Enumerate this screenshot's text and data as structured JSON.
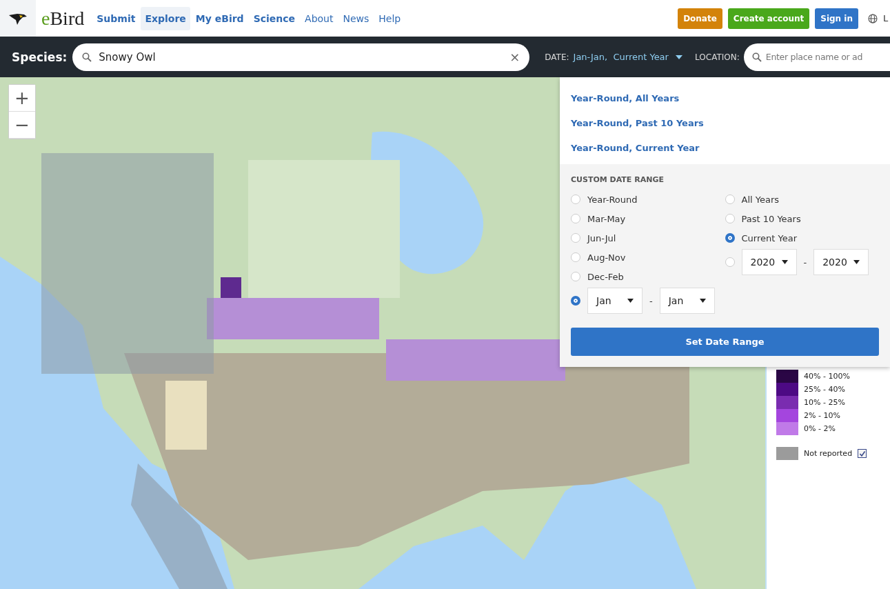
{
  "header": {
    "logo": {
      "prefix": "e",
      "name": "Bird"
    },
    "nav": [
      {
        "label": "Submit",
        "selected": false,
        "kind": "primary"
      },
      {
        "label": "Explore",
        "selected": true,
        "kind": "primary"
      },
      {
        "label": "My eBird",
        "selected": false,
        "kind": "primary"
      },
      {
        "label": "Science",
        "selected": false,
        "kind": "primary"
      },
      {
        "label": "About",
        "selected": false,
        "kind": "secondary"
      },
      {
        "label": "News",
        "selected": false,
        "kind": "secondary"
      },
      {
        "label": "Help",
        "selected": false,
        "kind": "secondary"
      }
    ],
    "buttons": [
      {
        "label": "Donate",
        "color": "#d3830a"
      },
      {
        "label": "Create account",
        "color": "#4aa81b"
      },
      {
        "label": "Sign in",
        "color": "#2f74c7"
      }
    ],
    "language": "L"
  },
  "toolbar": {
    "species_label": "Species:",
    "species_value": "Snowy Owl",
    "clear": "×",
    "date_label": "DATE:",
    "date_value": "Jan-Jan,  Current Year",
    "location_label": "LOCATION:",
    "location_placeholder": "Enter place name or ad"
  },
  "map": {
    "zoom_in": "+",
    "zoom_out": "−"
  },
  "date_menu": {
    "presets": [
      "Year-Round, All Years",
      "Year-Round, Past 10 Years",
      "Year-Round, Current Year"
    ],
    "custom_title": "CUSTOM DATE RANGE",
    "periods": [
      {
        "label": "Year-Round",
        "selected": false
      },
      {
        "label": "Mar-May",
        "selected": false
      },
      {
        "label": "Jun-Jul",
        "selected": false
      },
      {
        "label": "Aug-Nov",
        "selected": false
      },
      {
        "label": "Dec-Feb",
        "selected": false
      }
    ],
    "month_range": {
      "selected": true,
      "from": "Jan",
      "separator": "-",
      "to": "Jan"
    },
    "years": [
      {
        "label": "All Years",
        "selected": false
      },
      {
        "label": "Past 10 Years",
        "selected": false
      },
      {
        "label": "Current Year",
        "selected": true
      }
    ],
    "year_range": {
      "selected": false,
      "from": "2020",
      "separator": "-",
      "to": "2020"
    },
    "apply": "Set Date Range"
  },
  "legend": {
    "levels": [
      {
        "label": "40% - 100%",
        "color": "#2a0645"
      },
      {
        "label": "25% - 40%",
        "color": "#4d0a84"
      },
      {
        "label": "10% - 25%",
        "color": "#7a2cb0"
      },
      {
        "label": "2% - 10%",
        "color": "#a445de"
      },
      {
        "label": "0% - 2%",
        "color": "#c07ae8"
      }
    ],
    "not_reported": {
      "label": "Not reported",
      "color": "#9b9b9b",
      "checked": true
    }
  }
}
